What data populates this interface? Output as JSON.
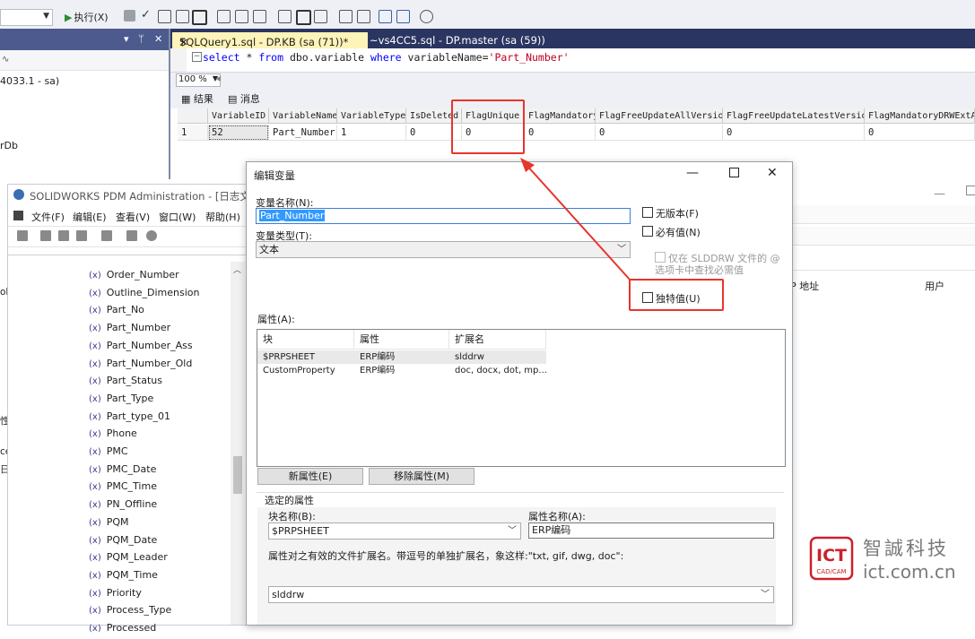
{
  "ssms": {
    "execute_label": "执行(X)",
    "tabs": {
      "active": "SQLQuery1.sql - DP.KB (sa (71))*",
      "inactive": "~vs4CC5.sql - DP.master (sa (59))"
    },
    "query": {
      "kw1": "select",
      "star": " * ",
      "kw2": "from",
      "table": " dbo.variable ",
      "kw3": "where",
      "col": " variableName=",
      "value": "'Part_Number'"
    },
    "zoom": "100 %",
    "result_tabs": [
      "结果",
      "消息"
    ],
    "grid": {
      "columns": [
        "VariableID",
        "VariableName",
        "VariableType",
        "IsDeleted",
        "FlagUnique",
        "FlagMandatory",
        "FlagFreeUpdateAllVersion",
        "FlagFreeUpdateLatestVersion",
        "FlagMandatoryDRWExtAtT"
      ],
      "row_number": "1",
      "row": [
        "52",
        "Part_Number",
        "1",
        "0",
        "0",
        "0",
        "0",
        "0",
        "0"
      ]
    },
    "object_explorer": {
      "server": "4033.1 - sa)",
      "item": "rDb"
    }
  },
  "pdm": {
    "title": "SOLIDWORKS PDM Administration - [日志文件",
    "menu": [
      "文件(F)",
      "编辑(E)",
      "查看(V)",
      "窗口(W)",
      "帮助(H)"
    ],
    "variable_prefix": "(x)",
    "variables": [
      "Order_Number",
      "Outline_Dimension",
      "Part_No",
      "Part_Number",
      "Part_Number_Ass",
      "Part_Number_Old",
      "Part_Status",
      "Part_Type",
      "Part_type_01",
      "Phone",
      "PMC",
      "PMC_Date",
      "PMC_Time",
      "PN_Offline",
      "PQM",
      "PQM_Date",
      "PQM_Leader",
      "PQM_Time",
      "Priority",
      "Process_Type",
      "Processed"
    ],
    "edge_fragments": [
      "ol",
      "性",
      "ce",
      "日"
    ]
  },
  "background_panel": {
    "col_address": "P 地址",
    "col_user": "用户"
  },
  "dialog": {
    "title": "编辑变量",
    "name_label": "变量名称(N):",
    "name_value": "Part_Number",
    "type_label": "变量类型(T):",
    "type_value": "文本",
    "checkboxes": {
      "no_version": "无版本(F)",
      "mandatory": "必有值(N)",
      "slddrw_only": "仅在 SLDDRW 文件的 @ 选项卡中查找必需值",
      "unique": "独特值(U)"
    },
    "attributes_label": "属性(A):",
    "attr_columns": [
      "块",
      "属性",
      "扩展名"
    ],
    "attr_rows": [
      [
        "$PRPSHEET",
        "ERP编码",
        "slddrw"
      ],
      [
        "CustomProperty",
        "ERP编码",
        "doc, docx, dot, mp..."
      ]
    ],
    "new_attr_button": "新属性(E)",
    "remove_attr_button": "移除属性(M)",
    "selected_group": "选定的属性",
    "block_name_label": "块名称(B):",
    "block_name_value": "$PRPSHEET",
    "attr_name_label": "属性名称(A):",
    "attr_name_value": "ERP编码",
    "ext_hint": "属性对之有效的文件扩展名。带逗号的单独扩展名，象这样:\"txt, gif, dwg, doc\":",
    "ext_value": "slddrw"
  },
  "watermark": {
    "logo": "ICT",
    "logo_sub": "CAD/CAM",
    "cn": "智誠科技",
    "url": "ict.com.cn"
  },
  "colors": {
    "annotation_red": "#e8342b",
    "active_tab_yellow": "#fef3b8",
    "tab_strip_navy": "#2a3661",
    "sql_keyword": "#0000ff",
    "sql_string": "#c0001b"
  }
}
